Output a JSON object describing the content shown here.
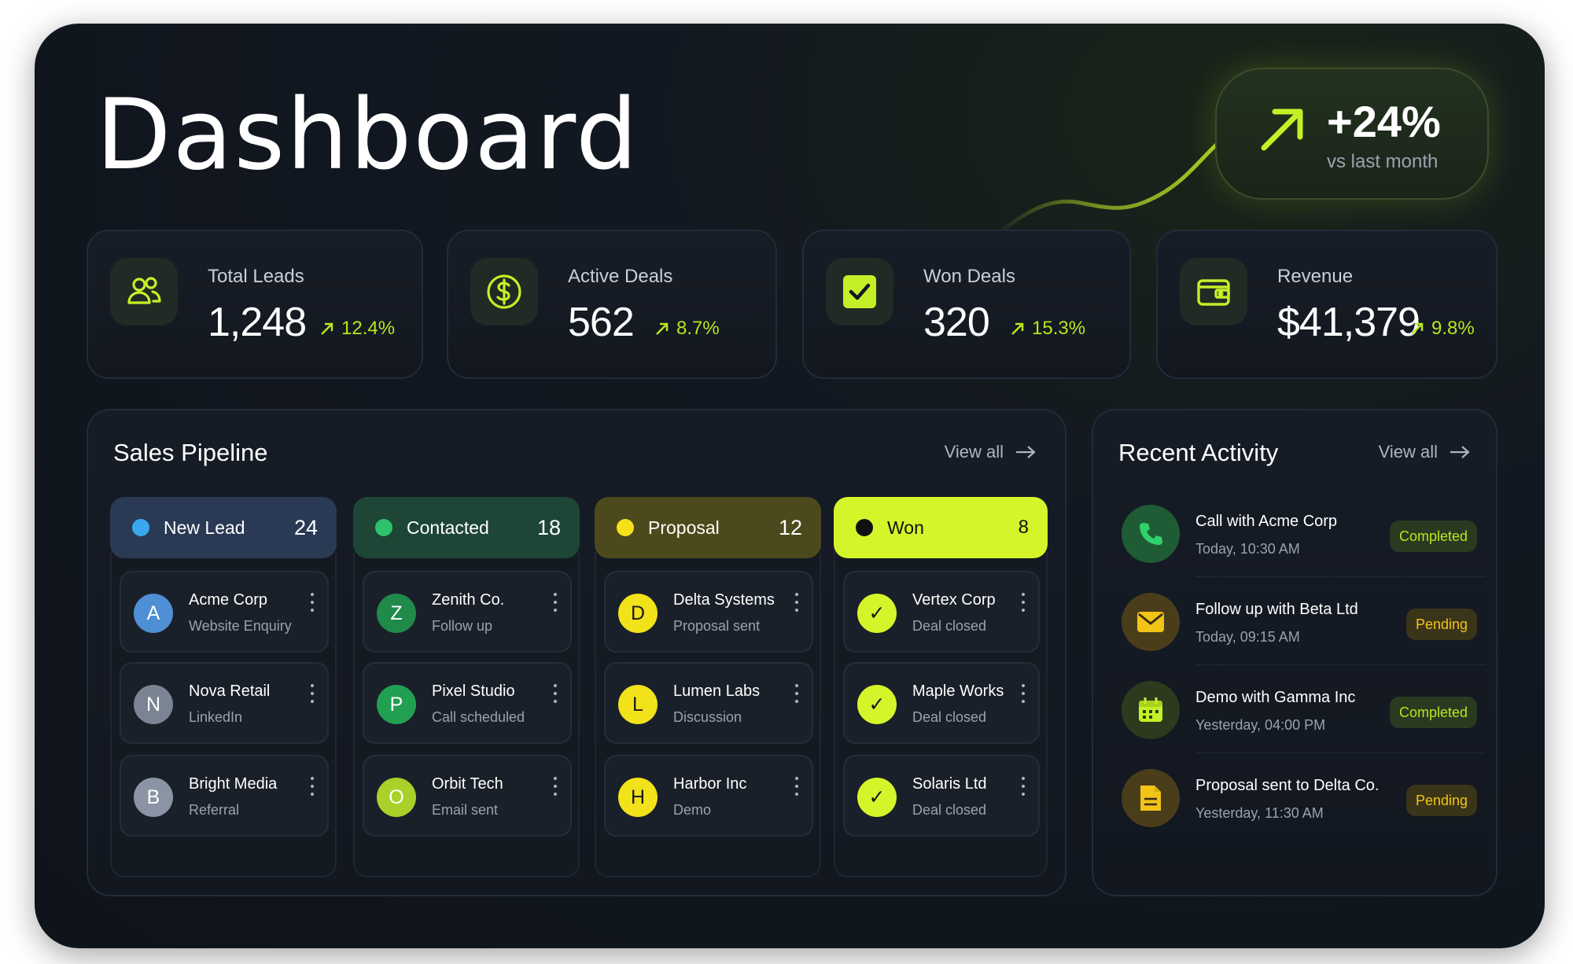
{
  "header": {
    "title": "Dashboard",
    "growth": {
      "value": "+24%",
      "label": "vs last month"
    }
  },
  "stats": [
    {
      "label": "Total Leads",
      "value": "1,248",
      "delta": "12.4%",
      "icon": "users-icon"
    },
    {
      "label": "Active Deals",
      "value": "562",
      "delta": "8.7%",
      "icon": "dollar-icon"
    },
    {
      "label": "Won Deals",
      "value": "320",
      "delta": "15.3%",
      "icon": "check-square-icon"
    },
    {
      "label": "Revenue",
      "value": "$41,379",
      "delta": "9.8%",
      "icon": "wallet-icon"
    }
  ],
  "pipeline": {
    "title": "Sales Pipeline",
    "view_all": "View all",
    "columns": [
      {
        "name": "New Lead",
        "count": "24",
        "dot_color": "#38a9f0",
        "deals": [
          {
            "initial": "A",
            "name": "Acme Corp",
            "sub": "Website Enquiry"
          },
          {
            "initial": "N",
            "name": "Nova Retail",
            "sub": "LinkedIn"
          },
          {
            "initial": "B",
            "name": "Bright Media",
            "sub": "Referral"
          }
        ]
      },
      {
        "name": "Contacted",
        "count": "18",
        "dot_color": "#2ec26a",
        "deals": [
          {
            "initial": "Z",
            "name": "Zenith Co.",
            "sub": "Follow up"
          },
          {
            "initial": "P",
            "name": "Pixel Studio",
            "sub": "Call scheduled"
          },
          {
            "initial": "O",
            "name": "Orbit Tech",
            "sub": "Email sent"
          }
        ]
      },
      {
        "name": "Proposal",
        "count": "12",
        "dot_color": "#f5e01a",
        "deals": [
          {
            "initial": "D",
            "name": "Delta Systems",
            "sub": "Proposal sent"
          },
          {
            "initial": "L",
            "name": "Lumen Labs",
            "sub": "Discussion"
          },
          {
            "initial": "H",
            "name": "Harbor Inc",
            "sub": "Demo"
          }
        ]
      },
      {
        "name": "Won",
        "count": "8",
        "dot_color": "#111111",
        "deals": [
          {
            "initial": "✓",
            "name": "Vertex Corp",
            "sub": "Deal closed"
          },
          {
            "initial": "✓",
            "name": "Maple Works",
            "sub": "Deal closed"
          },
          {
            "initial": "✓",
            "name": "Solaris Ltd",
            "sub": "Deal closed"
          }
        ]
      }
    ]
  },
  "activity": {
    "title": "Recent Activity",
    "view_all": "View all",
    "items": [
      {
        "title": "Call with Acme Corp",
        "time": "Today, 10:30 AM",
        "status": "Completed",
        "icon": "phone-icon"
      },
      {
        "title": "Follow up with Beta Ltd",
        "time": "Today, 09:15 AM",
        "status": "Pending",
        "icon": "mail-icon"
      },
      {
        "title": "Demo with Gamma Inc",
        "time": "Yesterday, 04:00 PM",
        "status": "Completed",
        "icon": "calendar-icon"
      },
      {
        "title": "Proposal sent to Delta Co.",
        "time": "Yesterday, 11:30 AM",
        "status": "Pending",
        "icon": "document-icon"
      }
    ]
  },
  "colors": {
    "accent": "#c4f028",
    "background": "#121821",
    "pending": "#f2c418"
  }
}
